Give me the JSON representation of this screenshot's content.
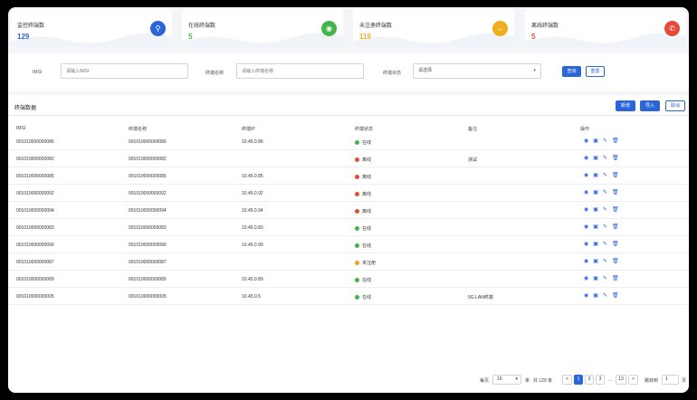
{
  "stats": [
    {
      "title": "监控终端数",
      "value": "129",
      "color": "#2b66d9",
      "icon": "monitor-icon",
      "glyph": "⚲"
    },
    {
      "title": "在线终端数",
      "value": "5",
      "color": "#44b549",
      "icon": "online-terminal-icon",
      "glyph": "◉"
    },
    {
      "title": "未注册终端数",
      "value": "119",
      "color": "#f0ad1c",
      "icon": "unregistered-icon",
      "glyph": "↔"
    },
    {
      "title": "离线终端数",
      "value": "5",
      "color": "#e54b3b",
      "icon": "offline-terminal-icon",
      "glyph": "✆"
    }
  ],
  "filter": {
    "imsi_label": "IMSI",
    "imsi_placeholder": "请输入IMSI",
    "name_label": "终端名称",
    "name_placeholder": "请输入终端名称",
    "status_label": "终端状态",
    "status_placeholder": "请选择",
    "query_label": "查询",
    "reset_label": "重置"
  },
  "panel": {
    "title": "终端数据",
    "add_label": "新增",
    "import_label": "导入",
    "cancel_label": "取消"
  },
  "table": {
    "headers": [
      "IMSI",
      "终端名称",
      "终端IP",
      "终端状态",
      "备注",
      "操作"
    ],
    "rows": [
      {
        "imsi": "001010000000086",
        "name": "001010000000086",
        "ip": "10.45.0.86",
        "status": "在线",
        "status_color": "#44b549",
        "note": ""
      },
      {
        "imsi": "001010000000082",
        "name": "001010000000082",
        "ip": "",
        "status": "离线",
        "status_color": "#e54b3b",
        "note": "测试"
      },
      {
        "imsi": "001010000000085",
        "name": "001010000000085",
        "ip": "10.45.0.85",
        "status": "离线",
        "status_color": "#e54b3b",
        "note": ""
      },
      {
        "imsi": "001010000000092",
        "name": "001010000000092",
        "ip": "10.45.0.92",
        "status": "离线",
        "status_color": "#e54b3b",
        "note": ""
      },
      {
        "imsi": "001010000000094",
        "name": "001010000000094",
        "ip": "10.45.0.94",
        "status": "离线",
        "status_color": "#e54b3b",
        "note": ""
      },
      {
        "imsi": "001010000000083",
        "name": "001010000000083",
        "ip": "10.45.0.83",
        "status": "在线",
        "status_color": "#44b549",
        "note": ""
      },
      {
        "imsi": "001010000000090",
        "name": "001010000000090",
        "ip": "10.45.0.90",
        "status": "在线",
        "status_color": "#44b549",
        "note": ""
      },
      {
        "imsi": "001010000000087",
        "name": "001010000000087",
        "ip": "",
        "status": "未注册",
        "status_color": "#f0a020",
        "note": ""
      },
      {
        "imsi": "001010000000089",
        "name": "001010000000089",
        "ip": "10.45.0.89",
        "status": "在线",
        "status_color": "#44b549",
        "note": ""
      },
      {
        "imsi": "001010000000005",
        "name": "001010000000005",
        "ip": "10.45.0.5",
        "status": "在线",
        "status_color": "#44b549",
        "note": "5G LAN终端"
      }
    ]
  },
  "pagination": {
    "per_page_label": "每页",
    "page_size": "10",
    "unit_label": "条",
    "total_label": "共 129 条",
    "prev": "<",
    "pages": [
      "1",
      "2",
      "3"
    ],
    "ellipsis": "…",
    "last_page": "13",
    "next": ">",
    "goto_label": "跳转到",
    "goto_value": "1",
    "page_suffix": "页"
  }
}
